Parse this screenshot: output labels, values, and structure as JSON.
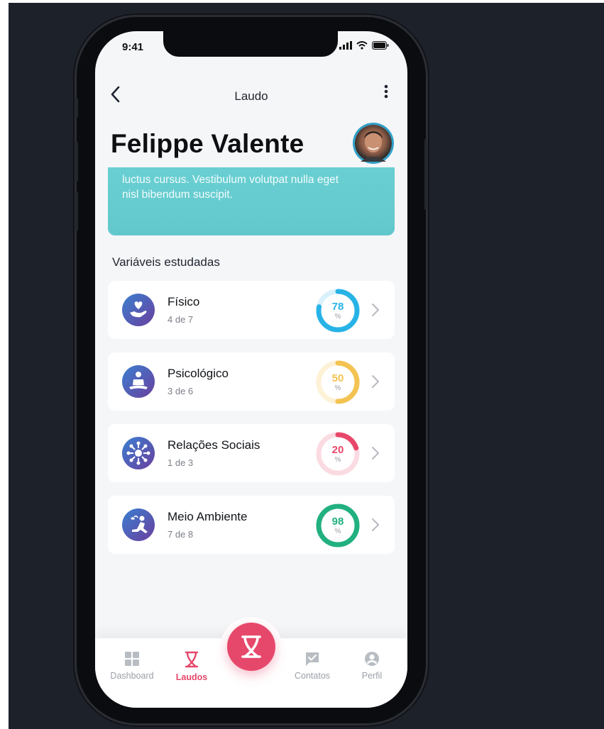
{
  "status": {
    "time": "9:41"
  },
  "nav": {
    "title": "Laudo"
  },
  "profile": {
    "name": "Felippe Valente",
    "summary_line_1": "luctus cursus. Vestibulum volutpat nulla eget",
    "summary_line_2": "nisl bibendum suscipit."
  },
  "section_title": "Variáveis estudadas",
  "variables": [
    {
      "name": "Físico",
      "count": "4 de 7",
      "percent": 78,
      "percent_label": "78",
      "pct_sign": "%",
      "color": "#28b3e6",
      "track": "#d8f1fb",
      "icon": "hand-heart-icon"
    },
    {
      "name": "Psicológico",
      "count": "3 de 6",
      "percent": 50,
      "percent_label": "50",
      "pct_sign": "%",
      "color": "#f3c352",
      "track": "#fdf1d6",
      "icon": "meditation-icon"
    },
    {
      "name": "Relações Sociais",
      "count": "1 de 3",
      "percent": 20,
      "percent_label": "20",
      "pct_sign": "%",
      "color": "#e8476a",
      "track": "#fbdbe2",
      "icon": "network-icon"
    },
    {
      "name": "Meio Ambiente",
      "count": "7 de 8",
      "percent": 98,
      "percent_label": "98",
      "pct_sign": "%",
      "color": "#21b07f",
      "track": "#d4f0e5",
      "icon": "planting-icon"
    }
  ],
  "tabs": [
    {
      "label": "Dashboard",
      "icon": "grid-icon",
      "active": false
    },
    {
      "label": "Laudos",
      "icon": "dna-icon",
      "active": true
    },
    {
      "label": "Contatos",
      "icon": "chat-check-icon",
      "active": false
    },
    {
      "label": "Perfil",
      "icon": "user-icon",
      "active": false
    }
  ],
  "colors": {
    "accent": "#e6486b",
    "teal": "#65cbcf",
    "inactive": "#9aa0a8"
  }
}
